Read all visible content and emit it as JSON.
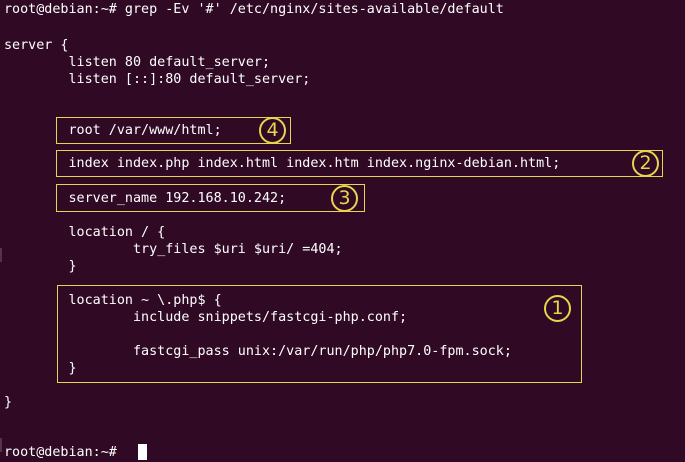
{
  "terminal": {
    "command_prompt": "root@debian:~# grep -Ev '#' /etc/nginx/sites-available/default",
    "lines": {
      "server_open": "server {",
      "listen_v4": "        listen 80 default_server;",
      "listen_v6": "        listen [::]:80 default_server;",
      "root": "        root /var/www/html;",
      "index": "        index index.php index.html index.htm index.nginx-debian.html;",
      "server_name": "        server_name 192.168.10.242;",
      "location_root_open": "        location / {",
      "try_files": "                try_files $uri $uri/ =404;",
      "location_root_close": "        }",
      "location_php_open": "        location ~ \\.php$ {",
      "include": "                include snippets/fastcgi-php.conf;",
      "fastcgi_pass": "                fastcgi_pass unix:/var/run/php/php7.0-fpm.sock;",
      "location_php_close": "        }",
      "server_close": "}"
    },
    "final_prompt": "root@debian:~# "
  },
  "annotations": {
    "root_marker": "4",
    "index_marker": "2",
    "server_name_marker": "3",
    "location_php_marker": "1"
  },
  "colors": {
    "background": "#300a24",
    "text": "#ffffff",
    "annotation": "#e8d44d"
  }
}
